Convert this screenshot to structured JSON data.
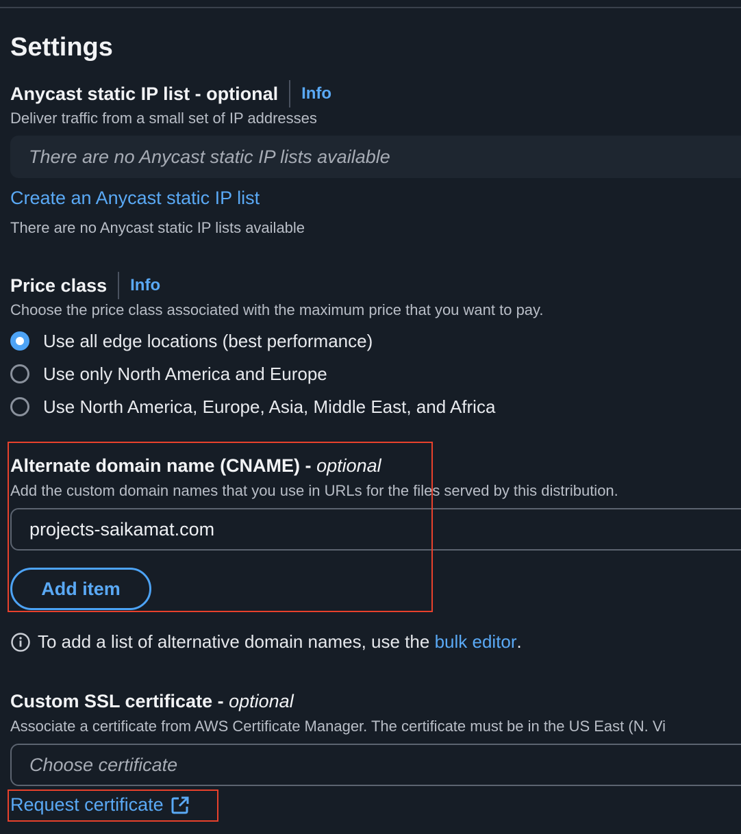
{
  "page": {
    "title": "Settings"
  },
  "anycast": {
    "label": "Anycast static IP list - optional",
    "info": "Info",
    "description": "Deliver traffic from a small set of IP addresses",
    "empty_box_text": "There are no Anycast static IP lists available",
    "create_link": "Create an Anycast static IP list",
    "status_text": "There are no Anycast static IP lists available"
  },
  "price_class": {
    "label": "Price class",
    "info": "Info",
    "description": "Choose the price class associated with the maximum price that you want to pay.",
    "options": [
      {
        "label": "Use all edge locations (best performance)",
        "selected": true
      },
      {
        "label": "Use only North America and Europe",
        "selected": false
      },
      {
        "label": "Use North America, Europe, Asia, Middle East, and Africa",
        "selected": false
      }
    ]
  },
  "cname": {
    "label_main": "Alternate domain name (CNAME) -",
    "label_optional": "optional",
    "description": "Add the custom domain names that you use in URLs for the files served by this distribution.",
    "value": "projects-saikamat.com",
    "add_button": "Add item",
    "note_prefix": "To add a list of alternative domain names, use the",
    "note_link": "bulk editor",
    "note_suffix": "."
  },
  "ssl": {
    "label_main": "Custom SSL certificate -",
    "label_optional": "optional",
    "description": "Associate a certificate from AWS Certificate Manager. The certificate must be in the US East (N. Vi",
    "placeholder": "Choose certificate",
    "request_link": "Request certificate"
  },
  "colors": {
    "background": "#161d26",
    "link": "#5aa9f5",
    "accent": "#4da3f5",
    "highlight": "#e8412c"
  },
  "icons": [
    "info-circle-icon",
    "external-link-icon"
  ]
}
